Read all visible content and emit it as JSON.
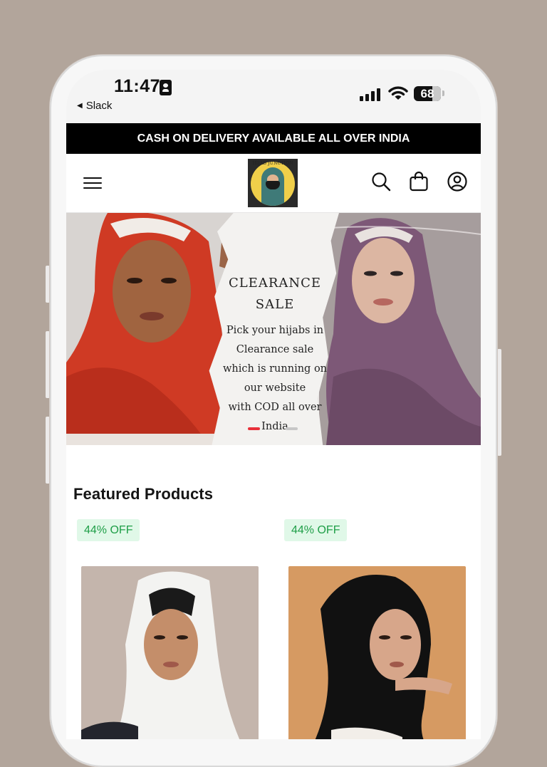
{
  "status_bar": {
    "time": "11:47",
    "back_app": "Slack",
    "battery_percent": "68",
    "battery_level": 0.68
  },
  "announcement": "CASH ON DELIVERY AVAILABLE ALL OVER INDIA",
  "header": {
    "logo_text": "HIJAB JUNCTION",
    "icons": [
      "menu-icon",
      "search-icon",
      "shopping-bag-icon",
      "account-icon"
    ]
  },
  "hero": {
    "title_line1": "CLEARANCE",
    "title_line2": "SALE",
    "body_lines": [
      "Pick your hijabs in",
      "Clearance sale",
      "which is running on",
      "our website",
      "with COD all over",
      "India"
    ],
    "slide_count": 2,
    "active_slide": 1
  },
  "featured": {
    "title": "Featured Products",
    "products": [
      {
        "badge": "44% OFF",
        "hijab_color": "#f3f3f1",
        "bg_color": "#c4b5ac"
      },
      {
        "badge": "44% OFF",
        "hijab_color": "#111111",
        "bg_color": "#d69a62"
      }
    ]
  },
  "colors": {
    "backdrop": "#b2a59b",
    "announcement_bg": "#000000",
    "badge_bg": "#e0f8e8",
    "badge_text": "#1e9e47",
    "slider_active": "#e8303a"
  }
}
